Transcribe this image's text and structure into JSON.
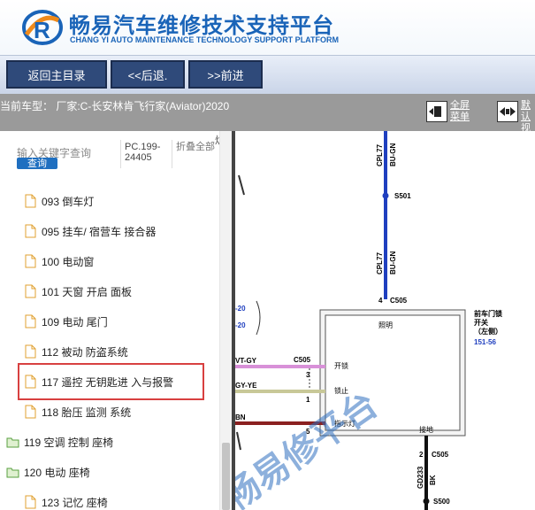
{
  "header": {
    "title_cn": "畅易汽车维修技术支持平台",
    "title_en": "CHANG YI AUTO MAINTENANCE TECHNOLOGY SUPPORT PLATFORM"
  },
  "toolbar": {
    "home_label": "返回主目录",
    "back_label": "<<后退.",
    "forward_label": ">>前进"
  },
  "vehicle": {
    "text": "当前车型：  厂家:C-长安林肯飞行家(Aviator)2020"
  },
  "tools": {
    "fullscreen": [
      "全屏",
      "菜单"
    ],
    "default": [
      "默认",
      "视图"
    ]
  },
  "sidebar": {
    "search_placeholder": "输入关键字查询",
    "search_button": "查询",
    "pc_code": "PC.199-24405",
    "fold_all": "折叠全部",
    "cut_label": "炉",
    "items": [
      {
        "label": "093 倒车灯",
        "type": "doc"
      },
      {
        "label": "095 挂车/ 宿营车 接合器",
        "type": "doc"
      },
      {
        "label": "100 电动窗",
        "type": "doc"
      },
      {
        "label": "101 天窗 开启 面板",
        "type": "doc"
      },
      {
        "label": "109 电动 尾门",
        "type": "doc"
      },
      {
        "label": "112 被动 防盗系统",
        "type": "doc"
      },
      {
        "label": "117 遥控 无钥匙进 入与报警",
        "type": "doc"
      },
      {
        "label": "118 胎压 监测 系统",
        "type": "doc"
      },
      {
        "label": "119 空调 控制 座椅",
        "type": "folder"
      },
      {
        "label": "120 电动 座椅",
        "type": "folder"
      },
      {
        "label": "123 记忆 座椅",
        "type": "doc"
      }
    ]
  },
  "diagram": {
    "wire_top_a": "CPL77",
    "wire_top_b": "BU-GN",
    "splice_1": "S501",
    "wire_mid_a": "CPL77",
    "wire_mid_b": "BU-GN",
    "pin_4": "4",
    "conn_c505": "C505",
    "module_lines": [
      "前车门锁",
      "开关",
      "（左侧）"
    ],
    "module_ref": "151-56",
    "lighting": "照明",
    "unlock": "开锁",
    "lock": "锁止",
    "indicator": "指示灯",
    "ground": "接地",
    "left_conn": "C505",
    "pin_3": "3",
    "pin_1": "1",
    "pin_5": "5",
    "pin_2": "2",
    "left_ref_a": "-20",
    "left_ref_b": "-20",
    "wire_vtgy": "VT-GY",
    "wire_gyye": "GY-YE",
    "wire_bn": "BN",
    "conn_c505_bottom": "C505",
    "wire_bottom_a": "GD233",
    "wire_bottom_b": "BK",
    "splice_2": "S500",
    "watermark": "畅易修平台",
    "colors": {
      "blue_wire": "#1f3fbf",
      "pink_wire": "#d890d8",
      "olive_wire": "#c8c898",
      "brown_wire": "#8b2020"
    }
  }
}
